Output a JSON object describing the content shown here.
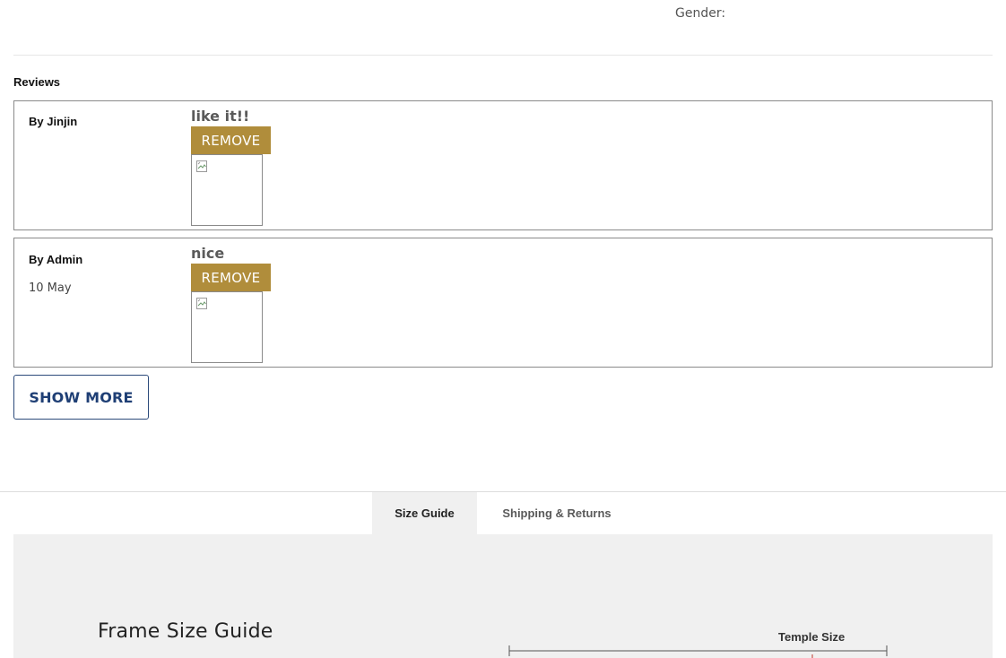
{
  "product": {
    "gender_label": "Gender:"
  },
  "reviews": {
    "title": "Reviews",
    "items": [
      {
        "author": "By Jinjin",
        "date": "",
        "text": "like it!!",
        "remove_label": "REMOVE"
      },
      {
        "author": "By Admin",
        "date": "10 May",
        "text": "nice",
        "remove_label": "REMOVE"
      }
    ],
    "show_more_label": "SHOW MORE"
  },
  "tabs": [
    {
      "label": "Size Guide",
      "active": true
    },
    {
      "label": "Shipping & Returns",
      "active": false
    }
  ],
  "size_guide": {
    "title": "Frame Size Guide",
    "diagram_label": "Temple Size"
  },
  "colors": {
    "remove_button": "#b08d3b",
    "show_more_text": "#1f3f75",
    "panel_bg": "#f0f0f0"
  }
}
